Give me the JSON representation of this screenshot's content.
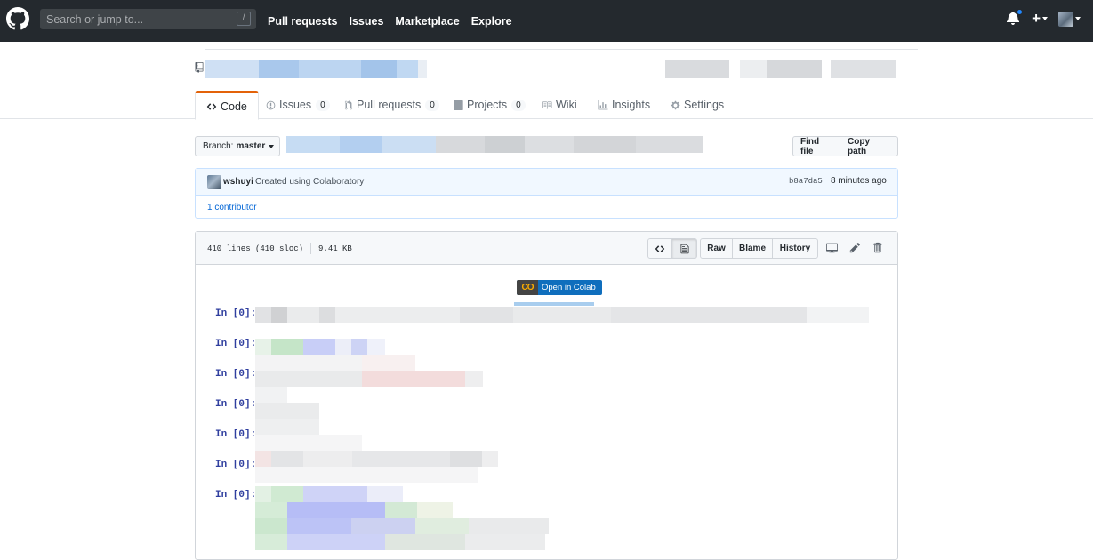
{
  "header": {
    "search_placeholder": "Search or jump to...",
    "search_shortcut": "/",
    "nav": [
      "Pull requests",
      "Issues",
      "Marketplace",
      "Explore"
    ]
  },
  "tabs": [
    {
      "label": "Code",
      "icon": "code-icon",
      "count": null
    },
    {
      "label": "Issues",
      "icon": "issue-icon",
      "count": "0"
    },
    {
      "label": "Pull requests",
      "icon": "pull-request-icon",
      "count": "0"
    },
    {
      "label": "Projects",
      "icon": "project-icon",
      "count": "0"
    },
    {
      "label": "Wiki",
      "icon": "book-icon",
      "count": null
    },
    {
      "label": "Insights",
      "icon": "graph-icon",
      "count": null
    },
    {
      "label": "Settings",
      "icon": "gear-icon",
      "count": null
    }
  ],
  "branch": {
    "prefix": "Branch:",
    "name": "master"
  },
  "file_actions": {
    "find_file": "Find file",
    "copy_path": "Copy path"
  },
  "commit": {
    "user": "wshuyi",
    "message": "Created using Colaboratory",
    "sha": "b8a7da5",
    "time": "8 minutes ago",
    "contributors": "1 contributor"
  },
  "file": {
    "lines": "410 lines (410 sloc)",
    "size": "9.41 KB",
    "buttons": {
      "raw": "Raw",
      "blame": "Blame",
      "history": "History"
    }
  },
  "colab_badge": {
    "logo": "CO",
    "text": "Open in Colab"
  },
  "prompts": [
    "In [0]:",
    "In [0]:",
    "In [0]:",
    "In [0]:",
    "In [0]:",
    "In [0]:",
    "In [0]:"
  ],
  "colors": {
    "header_bg": "#24292e",
    "link": "#0366d6",
    "tab_accent": "#e36209",
    "prompt": "#303f9f"
  }
}
